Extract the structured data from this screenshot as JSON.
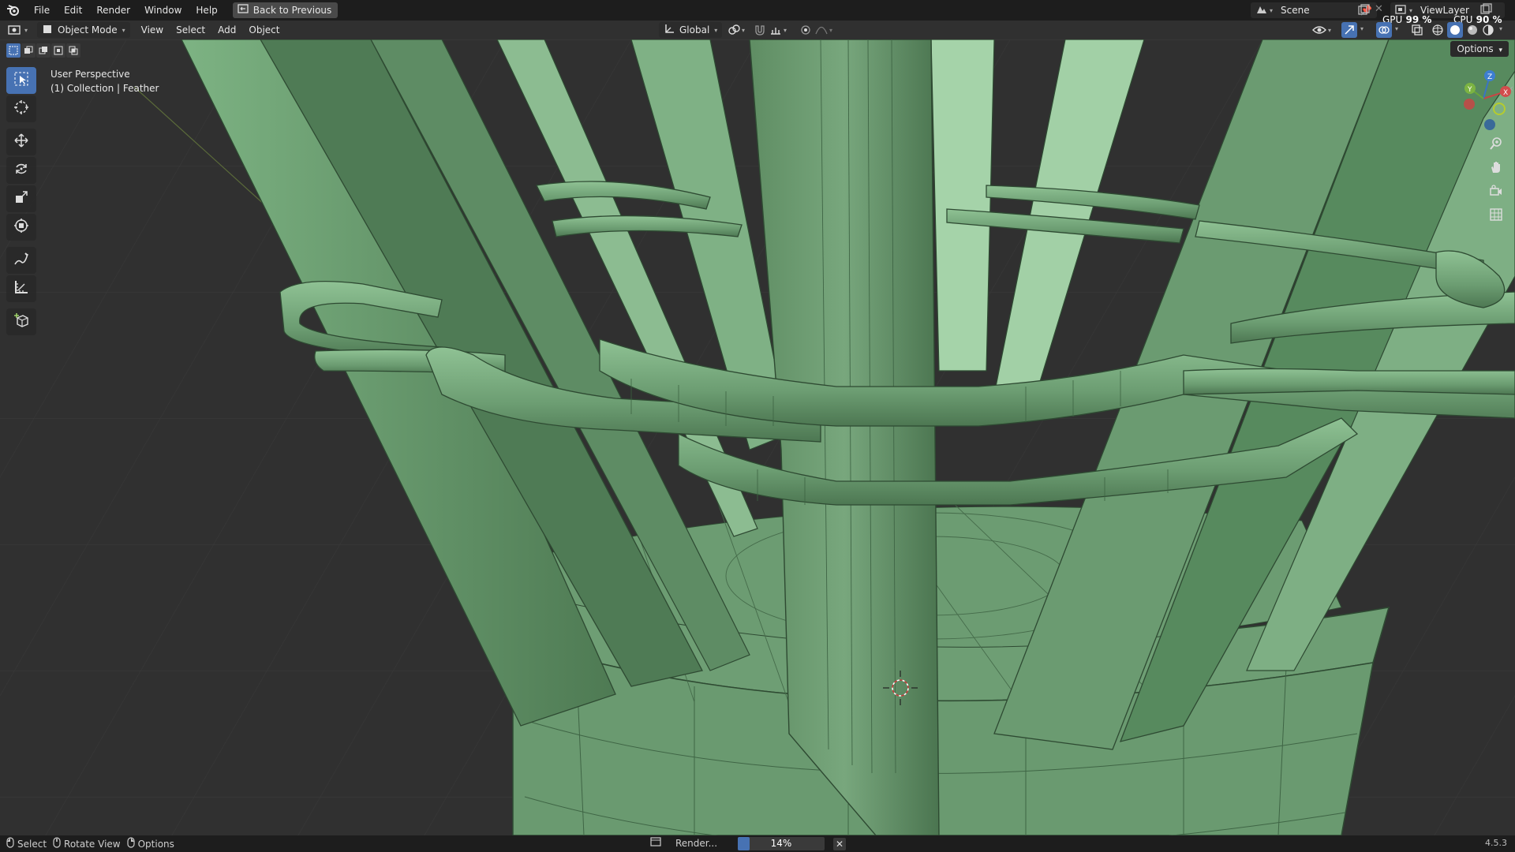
{
  "topbar": {
    "menus": [
      "File",
      "Edit",
      "Render",
      "Window",
      "Help"
    ],
    "back_button": "Back to Previous",
    "scene": "Scene",
    "view_layer": "ViewLayer",
    "gpu_label": "GPU",
    "gpu_value": "99 %",
    "cpu_label": "CPU",
    "cpu_value": "90 %"
  },
  "header": {
    "mode": "Object Mode",
    "menus": [
      "View",
      "Select",
      "Add",
      "Object"
    ],
    "transform_orientation": "Global",
    "options": "Options"
  },
  "viewport": {
    "view_name": "User Perspective",
    "collection_info": "(1) Collection | Feather"
  },
  "statusbar": {
    "select": "Select",
    "rotate_view": "Rotate View",
    "options": "Options",
    "render_label": "Render...",
    "render_progress": 0.14,
    "render_progress_text": "14%",
    "version": "4.5.3"
  },
  "colors": {
    "accent": "#4772b3",
    "model_green": "#6f9f75",
    "background": "#303030"
  }
}
